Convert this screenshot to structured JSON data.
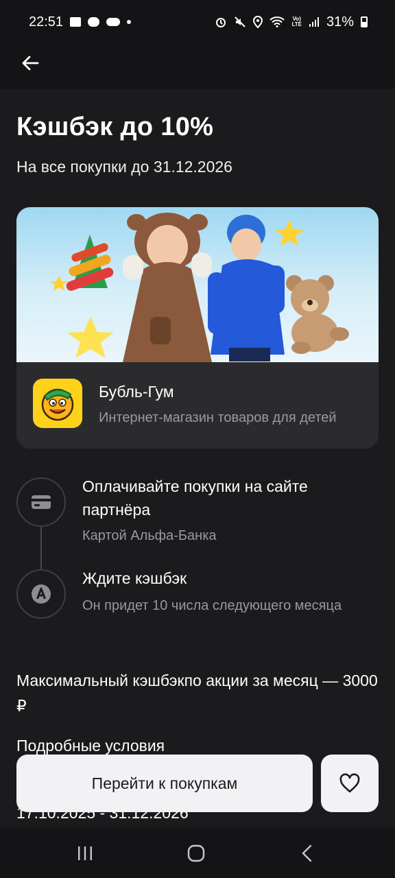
{
  "status_bar": {
    "time": "22:51",
    "battery": "31%",
    "volte": "Vo)\nLTE",
    "icons": [
      "gallery-icon",
      "message-icon",
      "wear-icon",
      "dot-icon",
      "alarm-icon",
      "mute-icon",
      "location-icon",
      "wifi-icon",
      "volte-icon",
      "signal-icon",
      "battery-icon"
    ]
  },
  "app_bar": {
    "back_icon": "arrow-left-icon"
  },
  "offer": {
    "title": "Кэшбэк до 10%",
    "subtitle": "На все покупки до 31.12.2026"
  },
  "partner": {
    "name": "Бубль-Гум",
    "description": "Интернет-магазин товаров для детей",
    "logo_color": "#ffd21a"
  },
  "steps": [
    {
      "icon": "card-icon",
      "title": "Оплачивайте покупки на сайте партнёра",
      "subtitle": "Картой Альфа-Банка"
    },
    {
      "icon": "alfa-logo-icon",
      "title": "Ждите кэшбэк",
      "subtitle": "Он придет 10 числа следующего месяца"
    }
  ],
  "max_cashback": "Максимальный кэшбэкпо акции за месяц — 3000 ₽",
  "details": {
    "title": "Подробные условия",
    "dates": "17.10.2025 - 31.12.2026"
  },
  "actions": {
    "go_label": "Перейти к покупкам",
    "favorite_icon": "heart-icon"
  },
  "nav_bar": {
    "items": [
      "recent-apps-icon",
      "home-icon",
      "back-icon"
    ]
  },
  "colors": {
    "background": "#1b1b1d",
    "card": "#2b2b2e",
    "button": "#f2f2f4",
    "muted_text": "#9a9a9e"
  }
}
